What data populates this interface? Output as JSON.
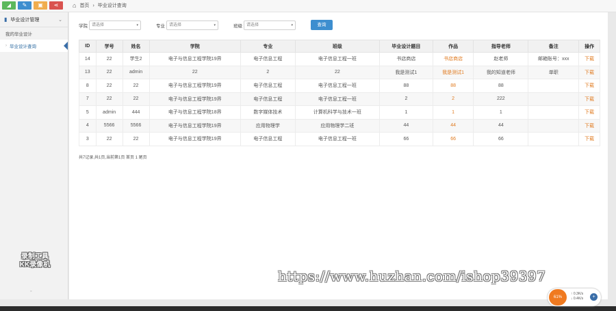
{
  "quick_buttons": [
    {
      "icon": "chart-icon",
      "glyph": "◢",
      "color": "#5cb85c"
    },
    {
      "icon": "pencil-icon",
      "glyph": "✎",
      "color": "#3d8ecf"
    },
    {
      "icon": "users-icon",
      "glyph": "▣",
      "color": "#f0ad4e"
    },
    {
      "icon": "share-icon",
      "glyph": "⋖",
      "color": "#d9534f"
    }
  ],
  "breadcrumb": {
    "home": "首页",
    "current": "毕业设计查询"
  },
  "sidebar": {
    "group_label": "毕业设计管理",
    "items": [
      {
        "label": "我的毕业设计",
        "active": false
      },
      {
        "label": "毕业设计查询",
        "active": true
      }
    ],
    "watermark_line1": "录制工具",
    "watermark_line2": "KK录像机"
  },
  "filters": {
    "college_label": "学院",
    "college_placeholder": "请选择",
    "major_label": "专业",
    "major_placeholder": "请选择",
    "class_label": "班级",
    "class_placeholder": "请选择",
    "search_button": "查询"
  },
  "table": {
    "columns": [
      "ID",
      "学号",
      "姓名",
      "学院",
      "专业",
      "班级",
      "毕业设计题目",
      "作品",
      "指导老师",
      "备注",
      "操作"
    ],
    "rows": [
      [
        "14",
        "22",
        "学生2",
        "电子与信息工程学院19界",
        "电子信息工程",
        "电子信息工程一班",
        "书店商店",
        "书店商店",
        "赵老师",
        "邮箱账号：xxx",
        "下载"
      ],
      [
        "13",
        "22",
        "admin",
        "22",
        "2",
        "22",
        "我是测试1",
        "我是测试1",
        "我的知道老师",
        "单职",
        "下载"
      ],
      [
        "8",
        "22",
        "22",
        "电子与信息工程学院19界",
        "电子信息工程",
        "电子信息工程一班",
        "88",
        "88",
        "88",
        "",
        "下载"
      ],
      [
        "7",
        "22",
        "22",
        "电子与信息工程学院19界",
        "电子信息工程",
        "电子信息工程一班",
        "2",
        "2",
        "222",
        "",
        "下载"
      ],
      [
        "5",
        "admin",
        "444",
        "电子与信息工程学院18界",
        "数字媒体技术",
        "计算机科学与技术一班",
        "1",
        "1",
        "1",
        "",
        "下载"
      ],
      [
        "4",
        "5566",
        "5566",
        "电子与信息工程学院19界",
        "应用物理学",
        "应用物理学二班",
        "44",
        "44",
        "44",
        "",
        "下载"
      ],
      [
        "3",
        "22",
        "22",
        "电子与信息工程学院19界",
        "电子信息工程",
        "电子信息工程一班",
        "66",
        "66",
        "66",
        "",
        "下载"
      ]
    ]
  },
  "summary": "共7记录,共1页,当前第1页 首页 1 尾页",
  "watermark": "https://www.huzhan.com/ishop39397",
  "speed_widget": {
    "percent": "61%",
    "up": "0.3K/s",
    "down": "0.4K/s",
    "button": "+"
  }
}
